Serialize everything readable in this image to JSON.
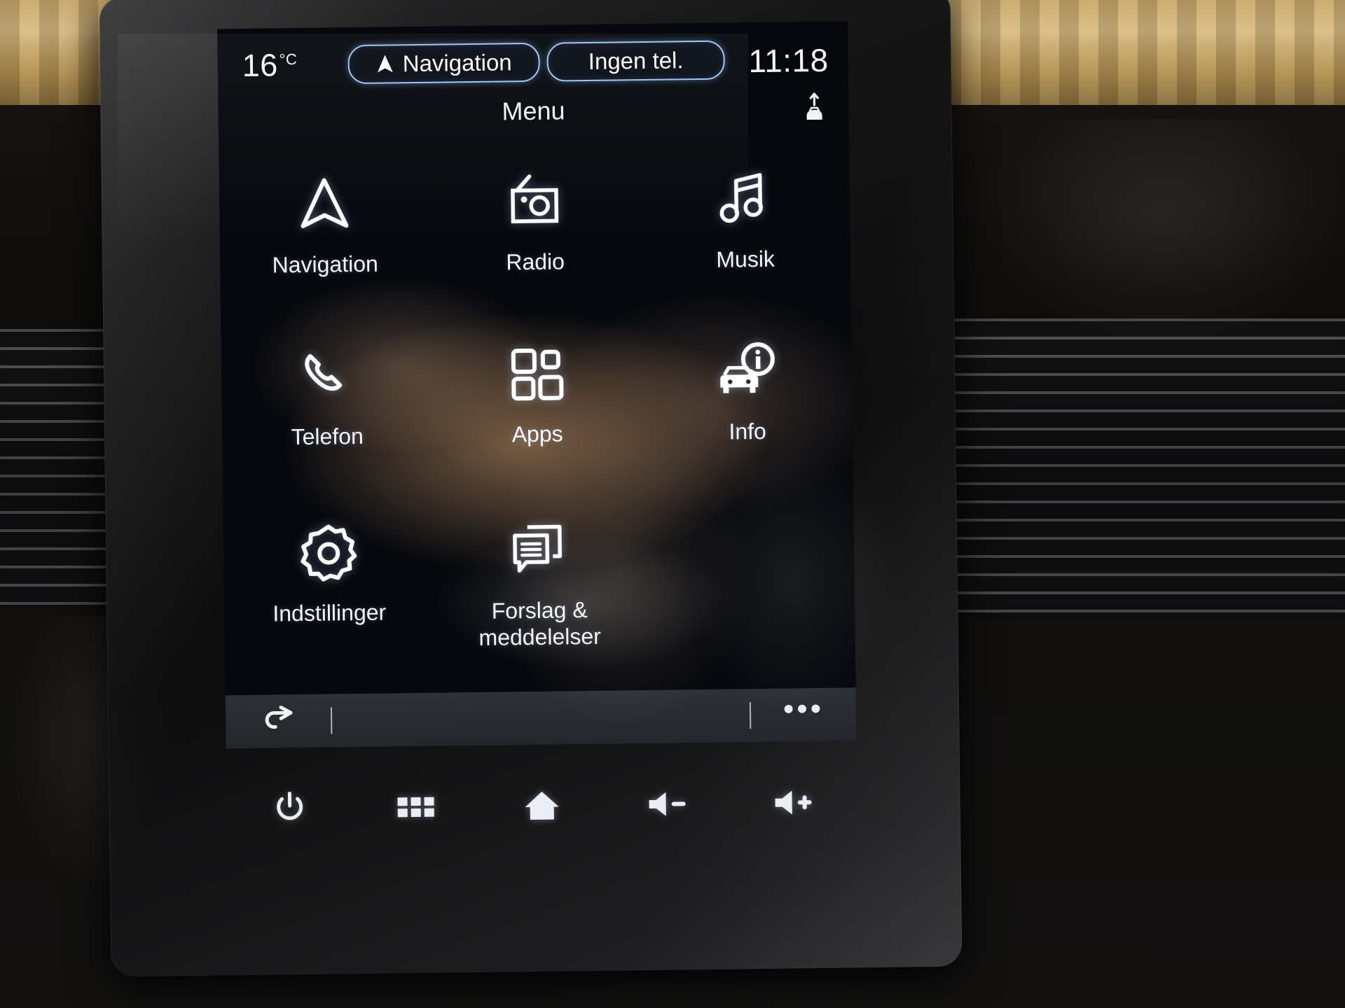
{
  "device": {
    "type": "car-infotainment-screen",
    "language": "da-DK"
  },
  "status_bar": {
    "temperature": "16",
    "temperature_unit": "°C",
    "nav_pill": {
      "label": "Navigation",
      "icon": "navigation-arrow-icon"
    },
    "phone_pill": {
      "label": "Ingen tel.",
      "icon": "none"
    },
    "clock": "11:18"
  },
  "header": {
    "title": "Menu",
    "right_icon": "car-update-arrows-icon"
  },
  "menu": {
    "rows": [
      [
        {
          "label": "Navigation",
          "icon": "navigation-arrow-icon"
        },
        {
          "label": "Radio",
          "icon": "radio-icon"
        },
        {
          "label": "Musik",
          "icon": "music-note-icon"
        }
      ],
      [
        {
          "label": "Telefon",
          "icon": "phone-handset-icon"
        },
        {
          "label": "Apps",
          "icon": "apps-grid-icon"
        },
        {
          "label": "Info",
          "icon": "car-info-icon"
        }
      ],
      [
        {
          "label": "Indstillinger",
          "icon": "gear-icon"
        },
        {
          "label": "Forslag &\nmeddelelser",
          "icon": "chat-bubbles-icon"
        }
      ]
    ]
  },
  "soft_toolbar": {
    "back": {
      "icon": "back-arrow-icon"
    },
    "more": {
      "label": "•••",
      "icon": "more-dots-icon"
    }
  },
  "hardware_bar": {
    "buttons": [
      {
        "name": "power",
        "icon": "power-icon"
      },
      {
        "name": "apps-grid",
        "icon": "grid-icon"
      },
      {
        "name": "home",
        "icon": "home-icon"
      },
      {
        "name": "volume-down",
        "icon": "speaker-minus-icon"
      },
      {
        "name": "volume-up",
        "icon": "speaker-plus-icon"
      }
    ]
  },
  "colors": {
    "screen_background": "#06080d",
    "accent_pill_border": "#9fc4ef",
    "text": "#f2f5fa",
    "soft_toolbar": "#2d3138"
  }
}
